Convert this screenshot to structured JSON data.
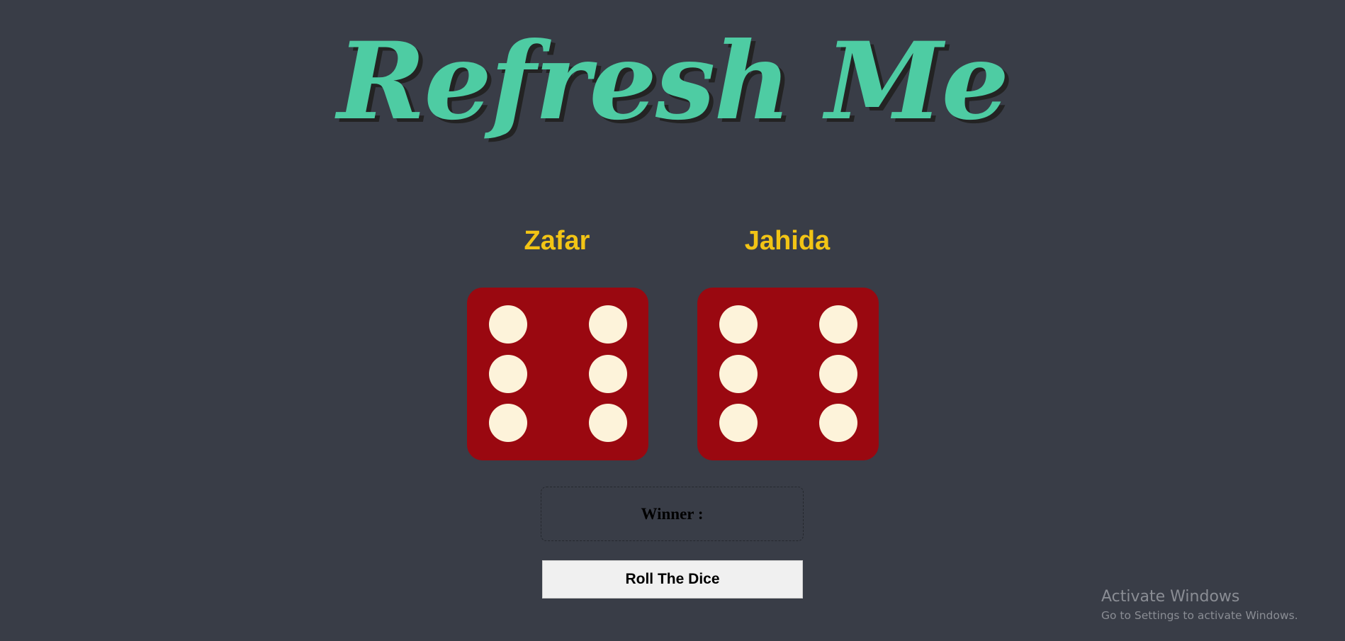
{
  "header": {
    "title": "Refresh Me"
  },
  "players": [
    {
      "name": "Zafar",
      "die_value": 6
    },
    {
      "name": "Jahida",
      "die_value": 6
    }
  ],
  "result": {
    "label": "Winner :"
  },
  "controls": {
    "roll_button_label": "Roll The Dice"
  },
  "watermark": {
    "title": "Activate Windows",
    "subtitle": "Go to Settings to activate Windows."
  },
  "colors": {
    "background": "#393d47",
    "title": "#4ecca3",
    "player_name": "#f2c415",
    "die": "#9a0810",
    "pip": "#fdf3da"
  }
}
